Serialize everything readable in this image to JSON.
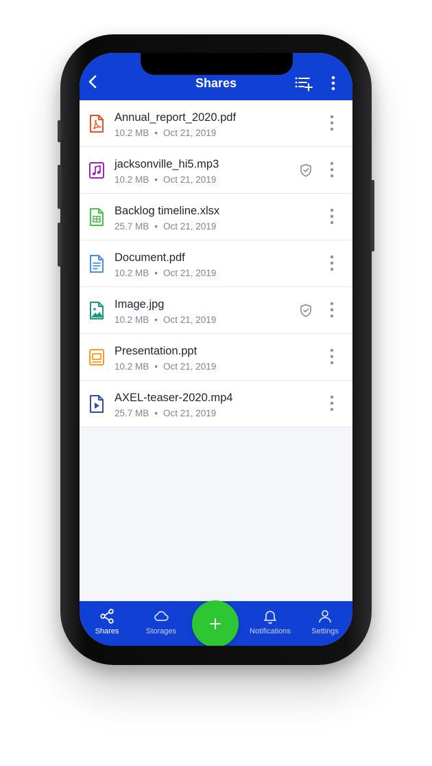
{
  "header": {
    "title": "Shares",
    "back_icon": "chevron-left-icon",
    "add_icon": "playlist-add-icon",
    "more_icon": "more-vertical-icon",
    "color": "#1140d4"
  },
  "files": [
    {
      "name": "Annual_report_2020.pdf",
      "size": "10.2 MB",
      "date": "Oct 21, 2019",
      "type": "pdf",
      "color": "#f0521f",
      "protected": false
    },
    {
      "name": "jacksonville_hi5.mp3",
      "size": "10.2 MB",
      "date": "Oct 21, 2019",
      "type": "audio",
      "color": "#9b27b0",
      "protected": true
    },
    {
      "name": "Backlog timeline.xlsx",
      "size": "25.7 MB",
      "date": "Oct 21, 2019",
      "type": "spreadsheet",
      "color": "#4fbf4f",
      "protected": false
    },
    {
      "name": "Document.pdf",
      "size": "10.2 MB",
      "date": "Oct 21, 2019",
      "type": "document",
      "color": "#4a8ef2",
      "protected": false
    },
    {
      "name": "Image.jpg",
      "size": "10.2 MB",
      "date": "Oct 21, 2019",
      "type": "image",
      "color": "#1b9a7e",
      "protected": true
    },
    {
      "name": "Presentation.ppt",
      "size": "10.2 MB",
      "date": "Oct 21, 2019",
      "type": "presentation",
      "color": "#f59a23",
      "protected": false
    },
    {
      "name": "AXEL-teaser-2020.mp4",
      "size": "25.7 MB",
      "date": "Oct 21, 2019",
      "type": "video",
      "color": "#3748b8",
      "protected": false
    }
  ],
  "meta_separator": "•",
  "tabs": [
    {
      "label": "Shares",
      "icon": "share-icon",
      "active": true
    },
    {
      "label": "Storages",
      "icon": "cloud-icon",
      "active": false
    },
    {
      "label": "Notifications",
      "icon": "bell-icon",
      "active": false
    },
    {
      "label": "Settings",
      "icon": "user-icon",
      "active": false
    }
  ],
  "fab": {
    "icon": "plus-icon",
    "color": "#2ec633"
  }
}
